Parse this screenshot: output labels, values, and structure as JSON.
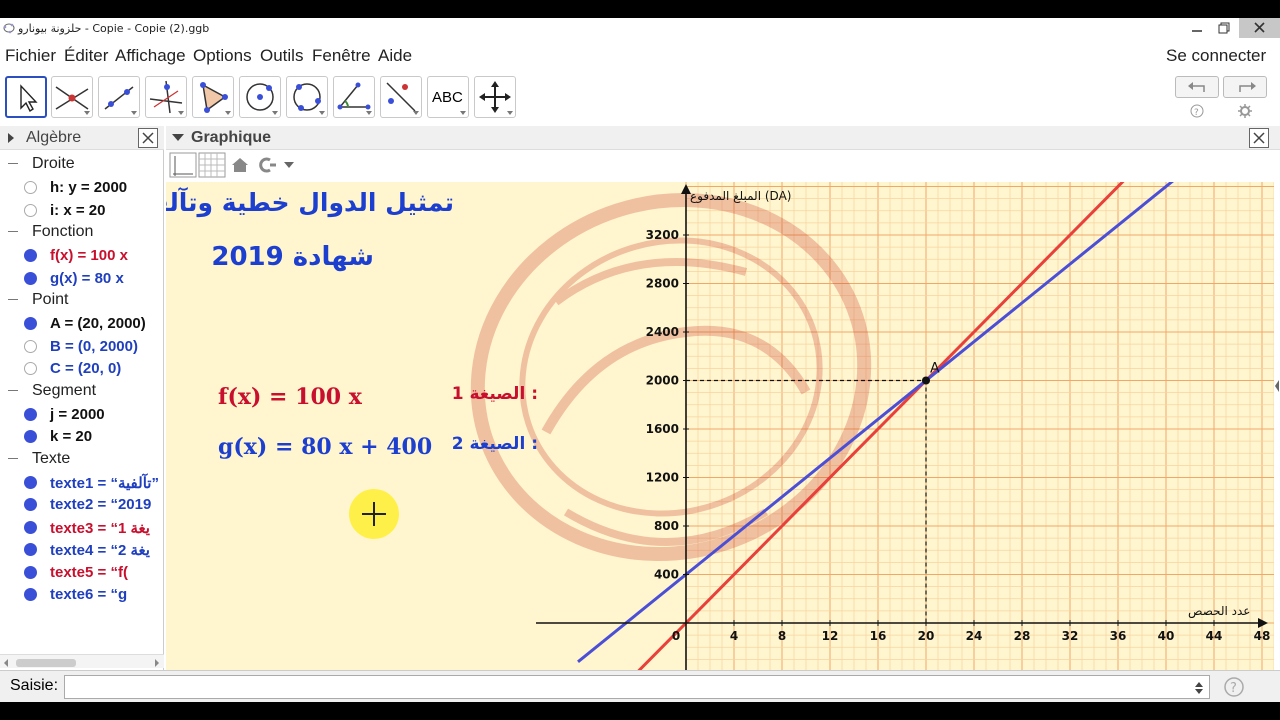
{
  "window": {
    "title": "حلزونة بيونارو - Copie - Copie (2).ggb"
  },
  "menu": {
    "items": [
      "Fichier",
      "Éditer",
      "Affichage",
      "Options",
      "Outils",
      "Fenêtre",
      "Aide"
    ],
    "connect": "Se connecter"
  },
  "toolbar": {
    "tools": [
      "move-tool",
      "point-tool",
      "line-tool",
      "perpendicular-line-tool",
      "polygon-tool",
      "circle-center-point-tool",
      "circle-three-points-tool",
      "angle-tool",
      "reflect-tool",
      "text-tool",
      "move-graphics-view-tool"
    ],
    "text_tool_label": "ABC"
  },
  "algebra": {
    "title": "Algèbre",
    "groups": [
      {
        "name": "Droite",
        "items": [
          {
            "text": "h: y = 2000",
            "color": "#111111",
            "shown": false
          },
          {
            "text": "i: x = 20",
            "color": "#111111",
            "shown": false
          }
        ]
      },
      {
        "name": "Fonction",
        "items": [
          {
            "text": "f(x) = 100 x",
            "color": "#c8102e",
            "shown": true
          },
          {
            "text": "g(x) = 80 x",
            "color": "#1f3fbf",
            "shown": true
          }
        ]
      },
      {
        "name": "Point",
        "items": [
          {
            "text": "A = (20, 2000)",
            "color": "#111111",
            "shown": true
          },
          {
            "text": "B = (0, 2000)",
            "color": "#1f3fbf",
            "shown": false
          },
          {
            "text": "C = (20, 0)",
            "color": "#1f3fbf",
            "shown": false
          }
        ]
      },
      {
        "name": "Segment",
        "items": [
          {
            "text": "j = 2000",
            "color": "#111111",
            "shown": true
          },
          {
            "text": "k = 20",
            "color": "#111111",
            "shown": true
          }
        ]
      },
      {
        "name": "Texte",
        "items": [
          {
            "text": "texte1 = “تآلفية”",
            "color": "#1f3fbf",
            "shown": true
          },
          {
            "text": "texte2 = “2019",
            "color": "#1f3fbf",
            "shown": true
          },
          {
            "text": "texte3 = “1 يغة",
            "color": "#c8102e",
            "shown": true
          },
          {
            "text": "texte4 = “2 يغة",
            "color": "#1f3fbf",
            "shown": true
          },
          {
            "text": "texte5 = “f(",
            "color": "#c8102e",
            "shown": true
          },
          {
            "text": "texte6 = “g",
            "color": "#1f3fbf",
            "shown": true
          }
        ]
      }
    ]
  },
  "graphics": {
    "title": "Graphique",
    "heading": "تمثيل الدوال خطية وتآلفية",
    "subheading": "شهادة 2019",
    "formula1_label": ": الصيغة 1",
    "formula1": "f(x) = 100 x",
    "formula2_label": ": الصيغة 2",
    "formula2": "g(x) = 80 x + 400",
    "point_label": "A",
    "y_axis_label": "المبلغ المدفوع (DA)",
    "x_axis_label": "عدد الحصص",
    "colors": {
      "f": "#e8403a",
      "g": "#4b4fd6",
      "heading_blue": "#1c3fd0",
      "formula_red": "#c8102e"
    }
  },
  "input": {
    "label": "Saisie:"
  },
  "chart_data": {
    "type": "line",
    "x_ticks": [
      0,
      4,
      8,
      12,
      16,
      20,
      24,
      28,
      32,
      36,
      40,
      44,
      48
    ],
    "y_ticks": [
      400,
      800,
      1200,
      1600,
      2000,
      2400,
      2800,
      3200
    ],
    "xlim": [
      -9,
      49
    ],
    "ylim": [
      -400,
      3600
    ],
    "series": [
      {
        "name": "f(x) = 100 x",
        "slope": 100,
        "intercept": 0,
        "color": "#e8403a"
      },
      {
        "name": "g(x) = 80 x + 400",
        "slope": 80,
        "intercept": 400,
        "color": "#4b4fd6"
      }
    ],
    "points": [
      {
        "label": "A",
        "x": 20,
        "y": 2000
      }
    ],
    "dashed_guides": [
      {
        "x": 20,
        "y": 2000
      }
    ]
  }
}
